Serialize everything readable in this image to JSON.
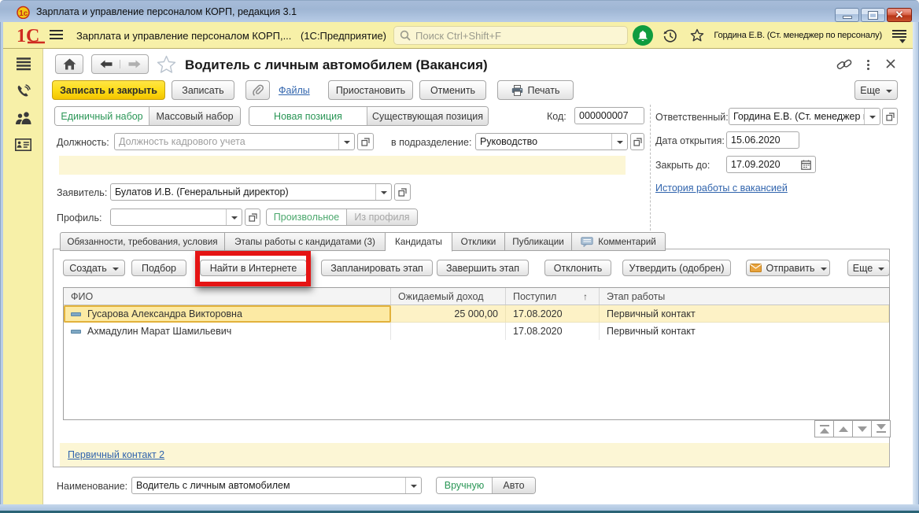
{
  "window": {
    "title": "Зарплата и управление персоналом КОРП, редакция 3.1"
  },
  "toolbar": {
    "app_title": "Зарплата и управление персоналом КОРП,...",
    "app_suffix": "(1С:Предприятие)",
    "search_placeholder": "Поиск Ctrl+Shift+F",
    "user": "Гордина Е.В. (Ст. менеджер по персоналу)"
  },
  "form": {
    "title": "Водитель с личным автомобилем (Вакансия)",
    "commands": {
      "save_close": "Записать и закрыть",
      "save": "Записать",
      "files": "Файлы",
      "suspend": "Приостановить",
      "cancel": "Отменить",
      "print": "Печать",
      "more": "Еще"
    },
    "toggles": {
      "single_set": "Единичный набор",
      "mass_set": "Массовый набор",
      "new_position": "Новая позиция",
      "existing_position": "Существующая позиция",
      "arbitrary": "Произвольное",
      "from_profile": "Из профиля",
      "manual": "Вручную",
      "auto": "Авто"
    },
    "fields": {
      "code_label": "Код:",
      "code_value": "000000007",
      "position_label": "Должность:",
      "position_placeholder": "Должность кадрового учета",
      "department_label": "в подразделение:",
      "department_value": "Руководство",
      "responsible_label": "Ответственный:",
      "responsible_value": "Гордина Е.В. (Ст. менеджер п",
      "open_date_label": "Дата открытия:",
      "open_date_value": "15.06.2020",
      "close_date_label": "Закрыть до:",
      "close_date_value": "17.09.2020",
      "history_link": "История работы с вакансией",
      "applicant_label": "Заявитель:",
      "applicant_value": "Булатов И.В. (Генеральный директор)",
      "profile_label": "Профиль:",
      "name_label": "Наименование:",
      "name_value": "Водитель с личным автомобилем"
    },
    "tabs": [
      {
        "label": "Обязанности, требования, условия"
      },
      {
        "label": "Этапы работы с кандидатами (3)"
      },
      {
        "label": "Кандидаты"
      },
      {
        "label": "Отклики"
      },
      {
        "label": "Публикации"
      },
      {
        "label": "Комментарий"
      }
    ],
    "candidates": {
      "buttons": {
        "create": "Создать",
        "selection": "Подбор",
        "find_internet": "Найти в Интернете",
        "plan_stage": "Запланировать этап",
        "finish_stage": "Завершить этап",
        "reject": "Отклонить",
        "approve": "Утвердить (одобрен)",
        "send": "Отправить",
        "more": "Еще"
      },
      "columns": [
        "ФИО",
        "Ожидаемый доход",
        "Поступил",
        "Этап работы"
      ],
      "sort_indicator": "↑",
      "rows": [
        {
          "name": "Гусарова Александра Викторовна",
          "income": "25 000,00",
          "received": "17.08.2020",
          "stage": "Первичный контакт"
        },
        {
          "name": "Ахмадулин Марат Шамильевич",
          "income": "",
          "received": "17.08.2020",
          "stage": "Первичный контакт"
        }
      ],
      "footer_link": "Первичный контакт 2"
    }
  },
  "colors": {
    "accent_yellow": "#f7f0a8",
    "button_yellow": "#fddc17",
    "selected_green": "#2a9656",
    "selection_row": "#fceaa4",
    "annotation_red": "#e51414",
    "link_blue": "#3064ad"
  }
}
